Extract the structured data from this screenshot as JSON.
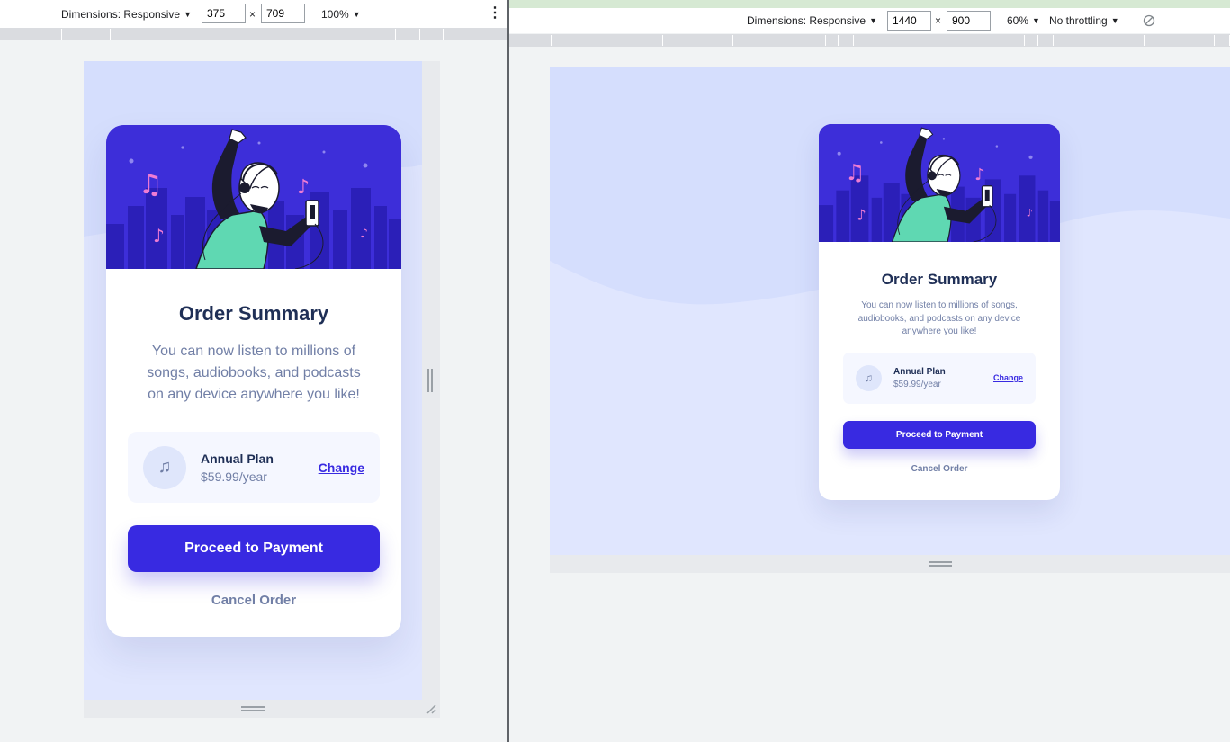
{
  "left_device": {
    "dimensions_label": "Dimensions: Responsive",
    "width_value": "375",
    "height_value": "709",
    "times_symbol": "×",
    "zoom_label": "100%",
    "menu_icon": "kebab-menu-icon"
  },
  "right_device": {
    "dimensions_label": "Dimensions: Responsive",
    "width_value": "1440",
    "height_value": "900",
    "times_symbol": "×",
    "zoom_label": "60%",
    "throttling_label": "No throttling",
    "rotate_icon": "rotate-disabled-icon"
  },
  "card": {
    "title": "Order Summary",
    "description": "You can now listen to millions of songs, audiobooks, and podcasts on any device anywhere you like!",
    "plan_icon": "music-note-icon",
    "plan_name": "Annual Plan",
    "plan_price": "$59.99/year",
    "change_label": "Change",
    "proceed_label": "Proceed to Payment",
    "cancel_label": "Cancel Order"
  },
  "colors": {
    "accent": "#382ae1",
    "hero_bg": "#3d2ed9",
    "page_bg": "#e0e6fe",
    "title": "#1f2f56",
    "muted": "#717fa6",
    "plan_bg": "#f5f7ff"
  }
}
